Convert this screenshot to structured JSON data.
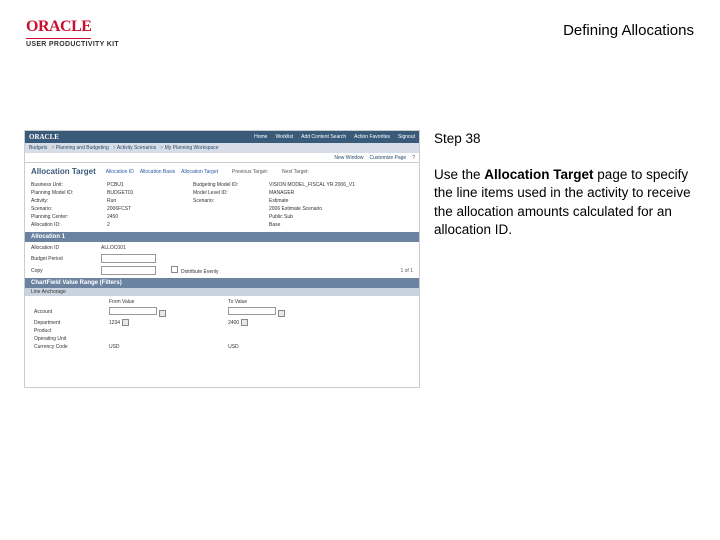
{
  "header": {
    "logo": "ORACLE",
    "logo_sub": "USER PRODUCTIVITY KIT",
    "doc_title": "Defining Allocations"
  },
  "step": {
    "label": "Step 38",
    "instruction_pre": "Use the ",
    "instruction_bold": "Allocation Target",
    "instruction_post": " page to specify the line items used in the activity to receive the allocation amounts calculated for an allocation ID."
  },
  "app": {
    "brand": "ORACLE",
    "menus": [
      "Home",
      "Worklist",
      "Add Content Search",
      "Action Favorites",
      "Signout"
    ],
    "breadcrumb": [
      "Budgets",
      "Planning and Budgeting",
      "Activity Scenarios",
      "My Planning Workspace"
    ],
    "toolbar": {
      "new_window": "New Window",
      "customize": "Customize Page"
    },
    "page_title": "Allocation Target",
    "page_links": [
      "Allocation ID",
      "Allocation Basis",
      "Allocation Target"
    ],
    "page_info1": "Previous Target:",
    "page_info2": "Next Target:",
    "fields": [
      {
        "l1": "Business Unit:",
        "v1": "PCBU1",
        "l2": "Budgeting Model ID:",
        "v2": "VISION MODEL_FISCAL YR 2006_V1"
      },
      {
        "l1": "Planning Model ID:",
        "v1": "BUDGET01",
        "l2": "Model Level ID:",
        "v2": "MANAGER"
      },
      {
        "l1": "Activity:",
        "v1": "Run",
        "l2": "Scenario:",
        "v2": "Estimate"
      },
      {
        "l1": "Scenario:",
        "v1": "2006FCST",
        "l2": "",
        "v2": "2006 Estimate Scenario"
      },
      {
        "l1": "Planning Center:",
        "v1": "2450",
        "l2": "",
        "v2": "Public Sub"
      },
      {
        "l1": "Allocation ID:",
        "v1": "2",
        "l2": "",
        "v2": "Base"
      }
    ],
    "section1": "Allocation 1",
    "alloc": {
      "alloc_id_label": "Allocation ID",
      "alloc_id_value": "ALLOC001",
      "budget_period_label": "Budget Period",
      "copy_label": "Copy",
      "distrib_label": "Distribute Evenly",
      "counter": "1 of 1"
    },
    "section2": "ChartField Value Range (Filters)",
    "subsection": "Line Anchorage",
    "cols": {
      "c1": "From Value",
      "c2": "To Value"
    },
    "rows": [
      {
        "label": "Account",
        "v1": "",
        "v2": ""
      },
      {
        "label": "Department",
        "v1": "1234",
        "v2": "2400"
      },
      {
        "label": "Product",
        "v1": "",
        "v2": ""
      },
      {
        "label": "Operating Unit",
        "v1": "",
        "v2": ""
      },
      {
        "label": "Currency Code",
        "v1": "USD",
        "v2": "USD"
      }
    ]
  }
}
